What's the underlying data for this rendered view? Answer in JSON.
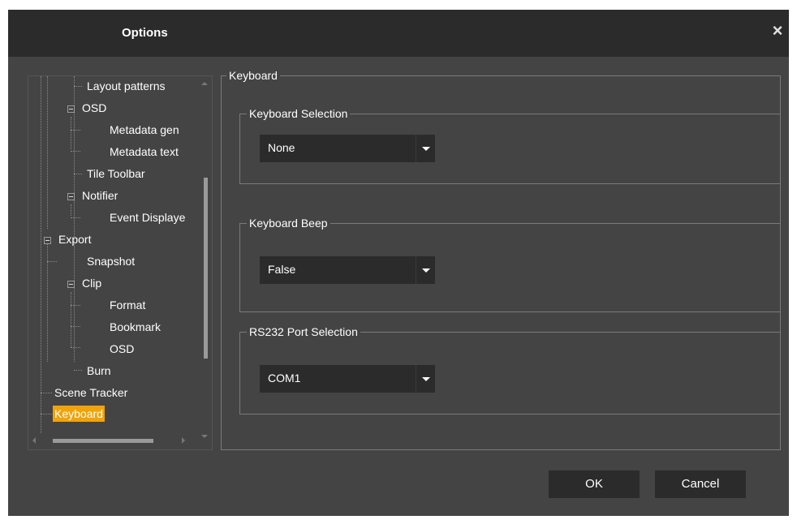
{
  "dialog": {
    "title": "Options",
    "close_icon": "×"
  },
  "tree": {
    "items": [
      {
        "label": "Layout patterns",
        "depth": 2
      },
      {
        "label": "OSD",
        "depth": 2,
        "expanded": true
      },
      {
        "label": "Metadata gen",
        "depth": 3
      },
      {
        "label": "Metadata text",
        "depth": 3
      },
      {
        "label": "Tile Toolbar",
        "depth": 2
      },
      {
        "label": "Notifier",
        "depth": 2,
        "expanded": true
      },
      {
        "label": "Event Displaye",
        "depth": 3
      },
      {
        "label": "Export",
        "depth": 1,
        "expanded": true
      },
      {
        "label": "Snapshot",
        "depth": 2
      },
      {
        "label": "Clip",
        "depth": 2,
        "expanded": true
      },
      {
        "label": "Format",
        "depth": 3
      },
      {
        "label": "Bookmark",
        "depth": 3
      },
      {
        "label": "OSD",
        "depth": 3
      },
      {
        "label": "Burn",
        "depth": 2
      },
      {
        "label": "Scene Tracker",
        "depth": 1
      },
      {
        "label": "Keyboard",
        "depth": 1,
        "selected": true
      }
    ],
    "selected_color": "#f0a30a"
  },
  "settings": {
    "group_title": "Keyboard",
    "keyboard_selection": {
      "legend": "Keyboard Selection",
      "value": "None"
    },
    "keyboard_beep": {
      "legend": "Keyboard Beep",
      "value": "False"
    },
    "rs232_port": {
      "legend": "RS232 Port Selection",
      "value": "COM1"
    }
  },
  "footer": {
    "ok_label": "OK",
    "cancel_label": "Cancel"
  },
  "icons": {
    "close": "close-icon",
    "dropdown": "chevron-down-icon",
    "tree_toggle": "minus-box-icon"
  }
}
